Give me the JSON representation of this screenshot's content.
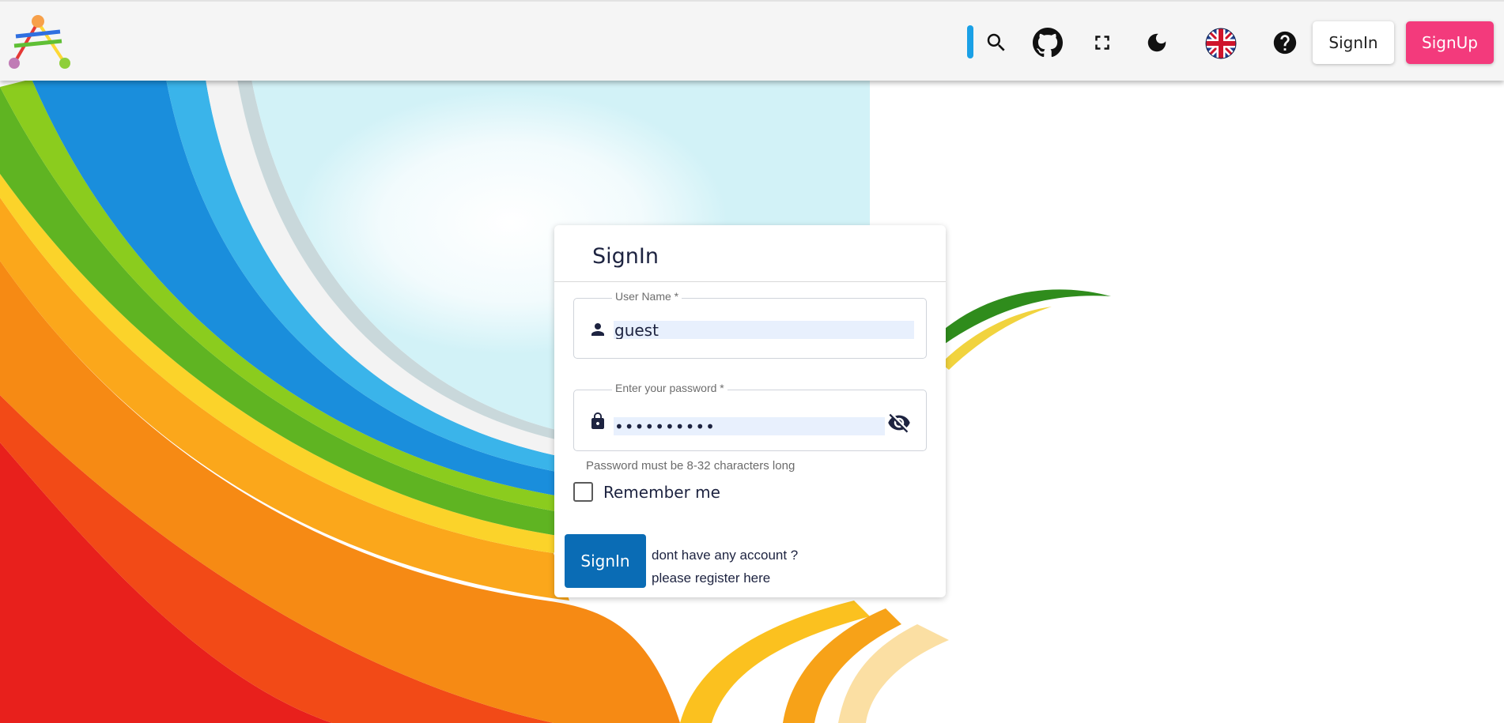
{
  "colors": {
    "header_bg": "#f5f5f5",
    "signup_accent": "#f33a7c",
    "primary_button": "#0a6cb5",
    "text_dark": "#1d2340",
    "autofill_bg": "#e8f0fd"
  },
  "header": {
    "logo_icon": "triangle-network-logo",
    "tools": [
      {
        "name": "search-icon"
      },
      {
        "name": "github-icon"
      },
      {
        "name": "fullscreen-icon"
      },
      {
        "name": "dark-mode-moon-icon"
      },
      {
        "name": "uk-flag-language-icon"
      },
      {
        "name": "help-icon"
      }
    ],
    "signin_label": "SignIn",
    "signup_label": "SignUp"
  },
  "login_card": {
    "title": "SignIn",
    "username": {
      "legend": "User Name *",
      "value": "guest",
      "icon": "person-icon"
    },
    "password": {
      "legend": "Enter your password *",
      "masked_value": "••••••••••",
      "icon": "lock-icon",
      "toggle_icon": "eye-off-icon",
      "hint": "Password must be 8-32 characters long"
    },
    "remember_label": "Remember me",
    "remember_checked": false,
    "submit_label": "SignIn",
    "no_account_text": "dont have any account ?",
    "register_link_text": "please register here"
  }
}
